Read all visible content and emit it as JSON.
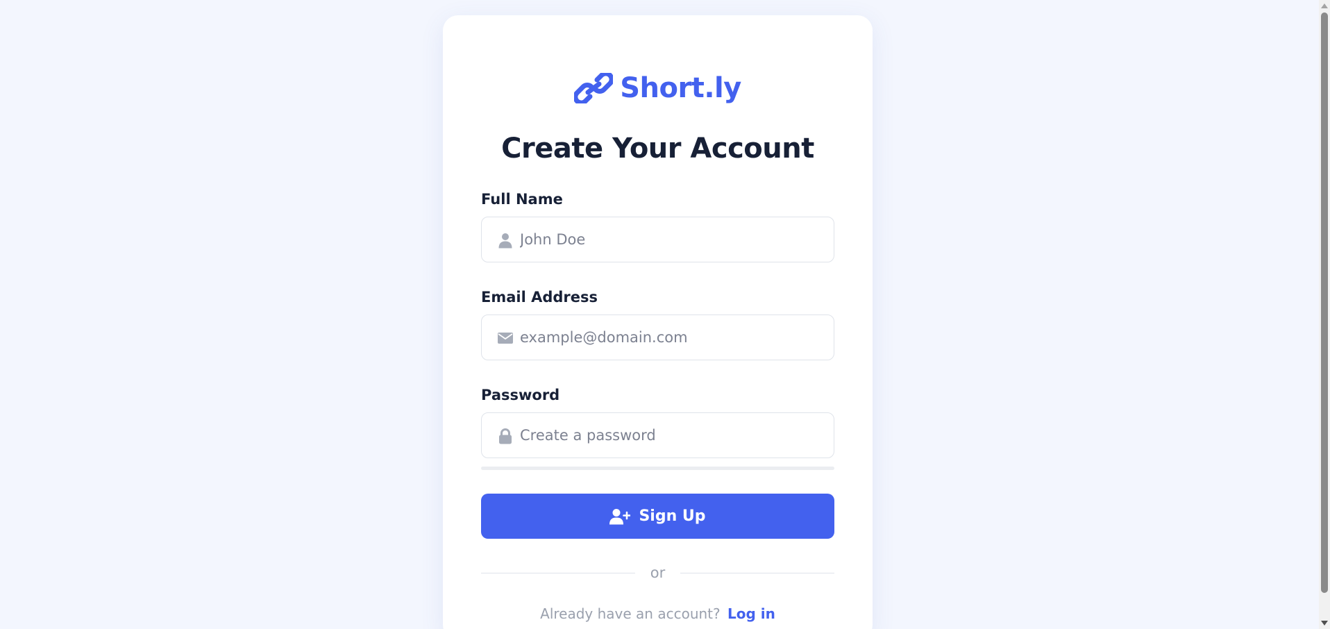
{
  "brand": {
    "name": "Short.ly",
    "icon": "link-icon",
    "color": "#4361ee"
  },
  "form": {
    "title": "Create Your Account",
    "fields": [
      {
        "label": "Full Name",
        "placeholder": "John Doe",
        "value": "",
        "icon": "user-icon",
        "type": "text"
      },
      {
        "label": "Email Address",
        "placeholder": "example@domain.com",
        "value": "",
        "icon": "envelope-icon",
        "type": "email"
      },
      {
        "label": "Password",
        "placeholder": "Create a password",
        "value": "",
        "icon": "lock-icon",
        "type": "password"
      }
    ],
    "submit_label": "Sign Up",
    "submit_icon": "user-plus-icon",
    "divider_text": "or",
    "footer_text": "Already have an account?",
    "login_label": "Log in"
  },
  "colors": {
    "background": "#f3f6fe",
    "card": "#ffffff",
    "accent": "#4361ee",
    "heading": "#172036",
    "muted": "#9aa0ad",
    "input_border": "#dfe3ea",
    "icon_gray": "#a6acb8"
  }
}
